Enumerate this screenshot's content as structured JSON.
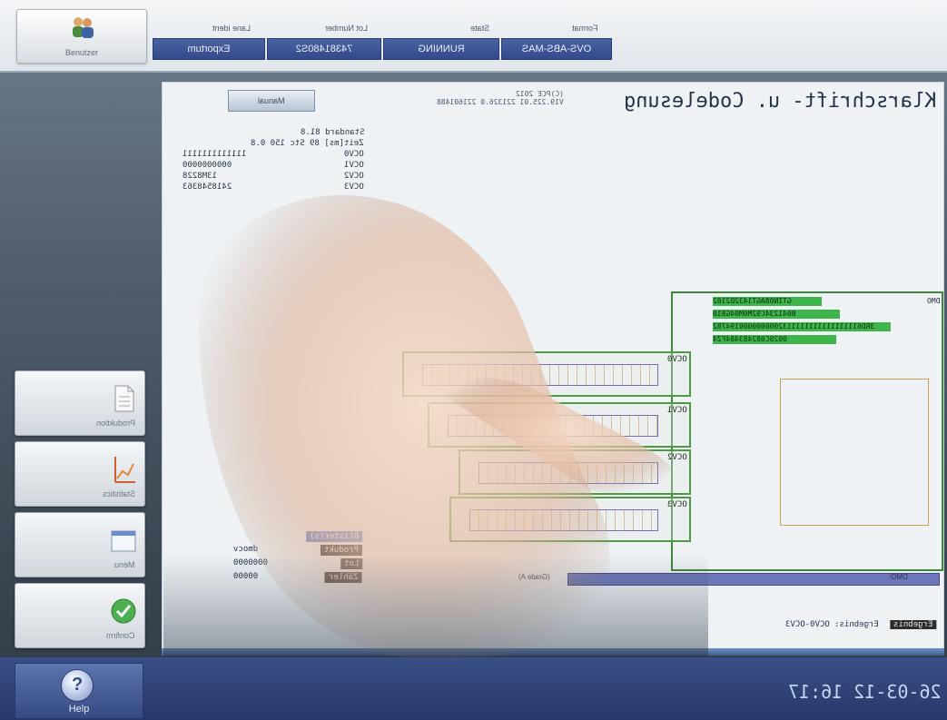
{
  "topbar": {
    "user_button_label": "Benutzer",
    "fields": [
      {
        "label": "Format",
        "value": "OVS-ABS-MAS"
      },
      {
        "label": "State",
        "value": "RUNNING"
      },
      {
        "label": "Lot Number",
        "value": "74381480S2"
      },
      {
        "label": "Lane ident",
        "value": "Exportum"
      }
    ]
  },
  "sidebar": {
    "items": [
      {
        "label": "Produktion",
        "icon": "document-icon"
      },
      {
        "label": "Statistics",
        "icon": "chart-icon"
      },
      {
        "label": "Menu",
        "icon": "window-icon"
      },
      {
        "label": "Confirm",
        "icon": "check-icon"
      }
    ]
  },
  "screen": {
    "title": "Klarschrift- u. Codelesung",
    "version_line1": "(C)PCE 2012",
    "version_line2": "V19.225.01 221326.0 221601488",
    "manual_button": "Manual",
    "ocv_header": "Standard 81.8",
    "ocv_meta": "Zeit[ms] 89   Stc 150 0.8",
    "ocv_rows": [
      {
        "k": "OCV0",
        "v": "1111111111111"
      },
      {
        "k": "OCV1",
        "v": "0000000000"
      },
      {
        "k": "OCV2",
        "v": "13M8228"
      },
      {
        "k": "OCV3",
        "v": "2418548363"
      }
    ],
    "detect_prefix": "DMO",
    "detect_lines": [
      "GTIN08AGT1432D2102",
      "B041234C92M0M04G810",
      "3RD6111111111111111132000000000194782",
      "0028C082483484FZ4"
    ],
    "ocv_labels": [
      "OCV0",
      "OCV1",
      "OCV2",
      "OCV3"
    ],
    "info": [
      {
        "k": "Blister(s)",
        "v": ""
      },
      {
        "k": "Produkt",
        "v": "dmocv"
      },
      {
        "k": "Lot",
        "v": "0000000"
      },
      {
        "k": "Zähler",
        "v": "00000"
      }
    ],
    "progress_label": "DMO:",
    "grade_label": "(Grade A)",
    "status_prefix": "OCV0-OCV3",
    "status_key": "Ergebnis:",
    "status_tag": "Ergebnis"
  },
  "bottom": {
    "help_label": "Help",
    "clock": "26-03-12 16:17"
  },
  "colors": {
    "accent_blue": "#33498a",
    "detect_green": "#3db54a",
    "box_green": "#3a8a3a"
  }
}
